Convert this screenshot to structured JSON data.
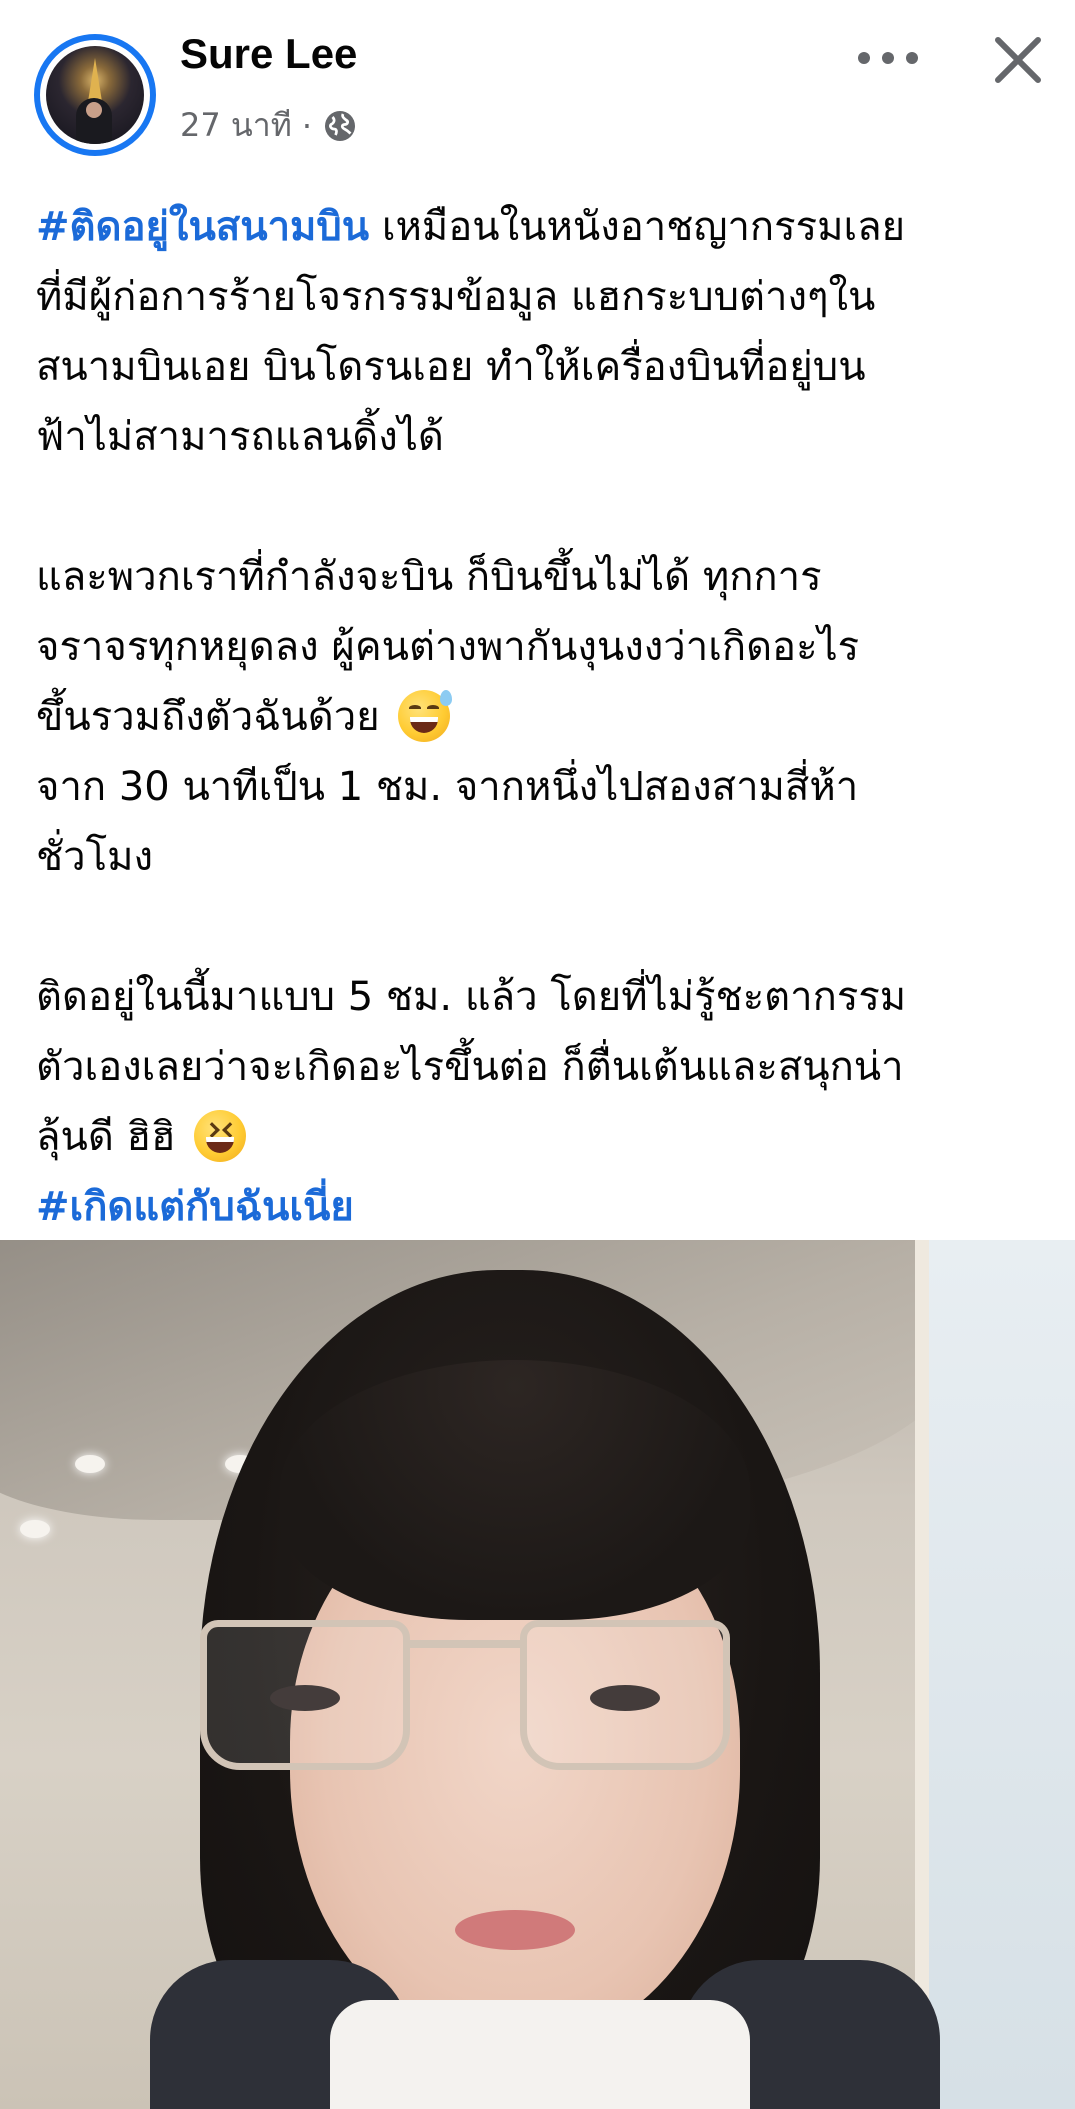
{
  "post": {
    "author": "Sure Lee",
    "time": "27 นาที",
    "separator": "·",
    "icons": {
      "privacy": "globe-icon",
      "more": "more-horizontal-icon",
      "close": "close-icon"
    },
    "text": {
      "hashtag_1": "#ติดอยู่ในสนามบิน",
      "line_1_rest": " เหมือนในหนังอาชญากรรมเลย",
      "line_2": "ที่มีผู้ก่อการร้ายโจรกรรมข้อมูล แฮกระบบต่างๆใน",
      "line_3": "สนามบินเอย บินโดรนเอย ทำให้เครื่องบินที่อยู่บน",
      "line_4": "ฟ้าไม่สามารถแลนดิ้งได้",
      "line_5": "และพวกเราที่กำลังจะบิน ก็บินขึ้นไม่ได้ ทุกการ",
      "line_6": "จราจรทุกหยุดลง ผู้คนต่างพากันงุนงงว่าเกิดอะไร",
      "line_7": "ขึ้นรวมถึงตัวฉันด้วย",
      "line_8": "จาก 30 นาทีเป็น 1 ชม. จากหนึ่งไปสองสามสี่ห้า",
      "line_9": "ชั่วโมง",
      "line_10": "ติดอยู่ในนี้มาแบบ 5 ชม. แล้ว โดยที่ไม่รู้ชะตากรรม",
      "line_11": "ตัวเองเลยว่าจะเกิดอะไรขึ้นต่อ ก็ตื่นเต้นและสนุกน่า",
      "line_12": "ลุ้นดี ฮิฮิ",
      "hashtag_2": "#เกิดแต่กับฉันเนี่ย"
    },
    "emoji_1": "grinning-sweat-emoji",
    "emoji_2": "laughing-squint-emoji",
    "colors": {
      "hashtag": "#1b6ad8",
      "avatar_ring": "#1877f2",
      "secondary_text": "#65676b"
    }
  }
}
